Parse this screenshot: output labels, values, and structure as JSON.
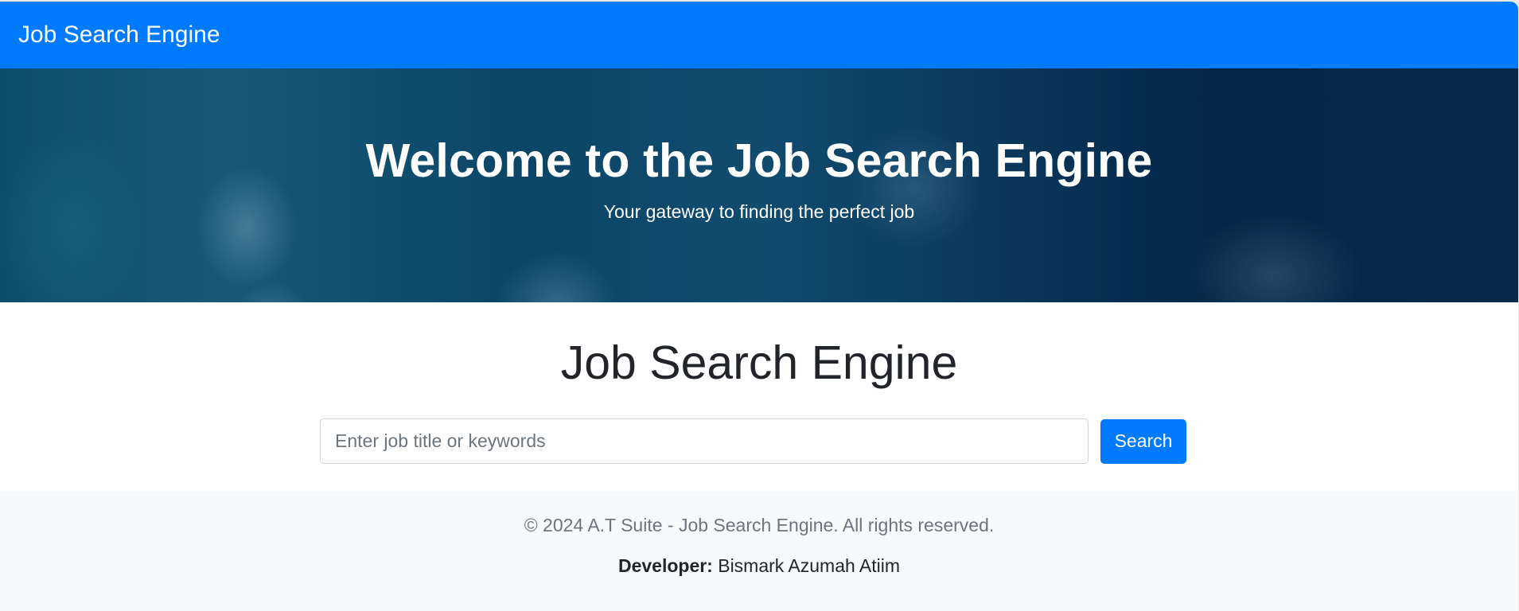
{
  "navbar": {
    "brand": "Job Search Engine",
    "color": "#007bff"
  },
  "hero": {
    "title": "Welcome to the Job Search Engine",
    "subtitle": "Your gateway to finding the perfect job"
  },
  "main": {
    "title": "Job Search Engine",
    "search": {
      "placeholder": "Enter job title or keywords",
      "value": "",
      "button_label": "Search"
    }
  },
  "footer": {
    "copyright": "© 2024 A.T Suite - Job Search Engine. All rights reserved.",
    "developer_label": "Developer:",
    "developer_name": "Bismark Azumah Atiim"
  }
}
